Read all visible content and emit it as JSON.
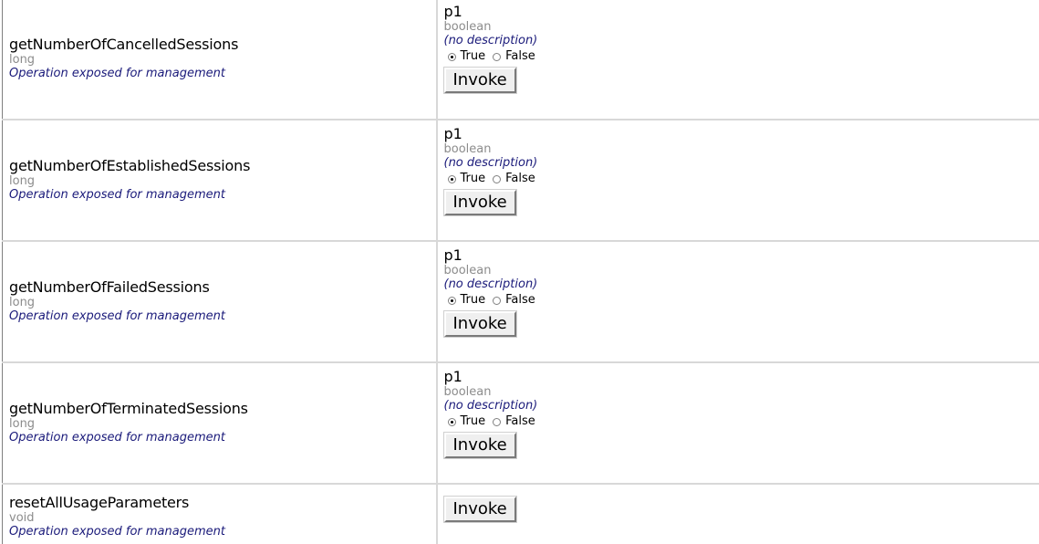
{
  "operations": [
    {
      "name": "getNumberOfCancelledSessions",
      "type": "long",
      "description": "Operation exposed for management",
      "param": {
        "name": "p1",
        "type": "boolean",
        "description": "(no description)",
        "true_label": "True",
        "false_label": "False",
        "selected": "True"
      },
      "invoke_label": "Invoke"
    },
    {
      "name": "getNumberOfEstablishedSessions",
      "type": "long",
      "description": "Operation exposed for management",
      "param": {
        "name": "p1",
        "type": "boolean",
        "description": "(no description)",
        "true_label": "True",
        "false_label": "False",
        "selected": "True"
      },
      "invoke_label": "Invoke"
    },
    {
      "name": "getNumberOfFailedSessions",
      "type": "long",
      "description": "Operation exposed for management",
      "param": {
        "name": "p1",
        "type": "boolean",
        "description": "(no description)",
        "true_label": "True",
        "false_label": "False",
        "selected": "True"
      },
      "invoke_label": "Invoke"
    },
    {
      "name": "getNumberOfTerminatedSessions",
      "type": "long",
      "description": "Operation exposed for management",
      "param": {
        "name": "p1",
        "type": "boolean",
        "description": "(no description)",
        "true_label": "True",
        "false_label": "False",
        "selected": "True"
      },
      "invoke_label": "Invoke"
    },
    {
      "name": "resetAllUsageParameters",
      "type": "void",
      "description": "Operation exposed for management",
      "invoke_label": "Invoke"
    }
  ],
  "colors": {
    "type_text": "#8c8c8c",
    "description_text": "#1a1a7a",
    "row_divider": "#d8d8d8"
  }
}
